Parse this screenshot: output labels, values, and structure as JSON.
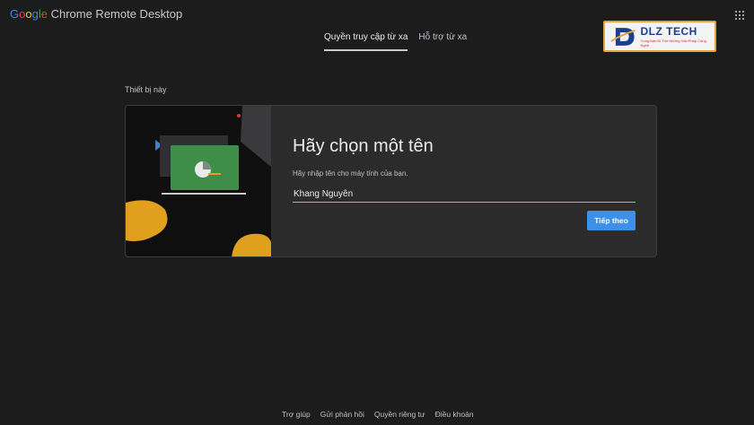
{
  "header": {
    "brand_google": [
      "G",
      "o",
      "o",
      "g",
      "l",
      "e"
    ],
    "brand_product": "Chrome Remote Desktop",
    "apps_icon": "grid-apps-icon"
  },
  "tabs": [
    {
      "label": "Quyền truy cập từ xa",
      "active": true
    },
    {
      "label": "Hỗ trợ từ xa",
      "active": false
    }
  ],
  "watermark": {
    "title": "DLZ TECH",
    "subtitle": "Cùng Bạn Đi Tìm Những Giải Pháp Công Nghệ"
  },
  "section": {
    "label": "Thiết bị này"
  },
  "card": {
    "title": "Hãy chọn một tên",
    "hint": "Hãy nhập tên cho máy tính của bạn.",
    "input_value": "Khang Nguyễn",
    "next_label": "Tiếp theo"
  },
  "footer": {
    "links": [
      "Trợ giúp",
      "Gửi phản hồi",
      "Quyền riêng tư",
      "Điều khoản"
    ]
  },
  "colors": {
    "background": "#1c1c1d",
    "card": "#2b2b2c",
    "accent": "#3d8fe8",
    "illustration_yellow": "#e0a01e",
    "illustration_green": "#3e8e4a"
  }
}
